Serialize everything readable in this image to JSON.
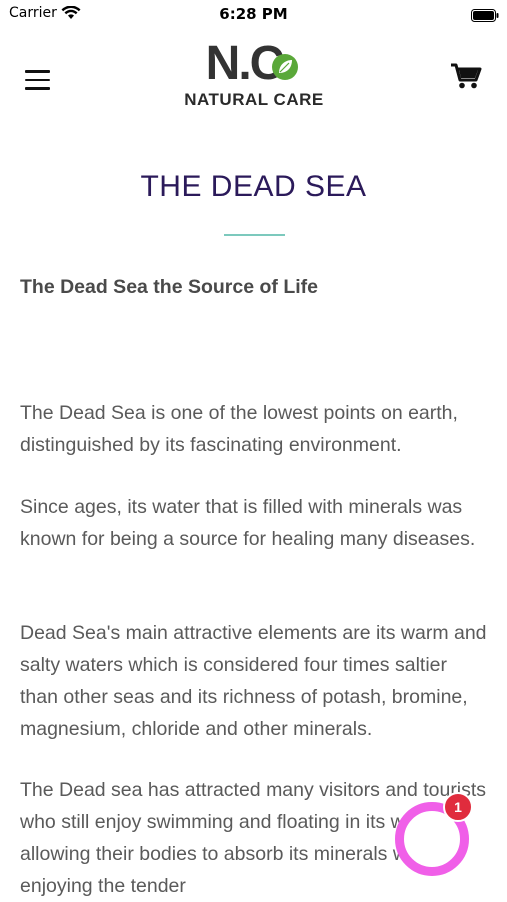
{
  "status_bar": {
    "carrier": "Carrier",
    "time": "6:28 PM"
  },
  "header": {
    "logo_letters": "N.C",
    "logo_text": "NATURAL CARE",
    "menu_icon": "hamburger-menu-icon",
    "cart_icon": "shopping-cart-icon"
  },
  "page": {
    "title": "THE DEAD SEA",
    "subtitle": "The Dead Sea the Source of Life",
    "paragraphs": [
      "The Dead Sea is one of the lowest points on earth, distinguished by its fascinating environment.",
      "Since ages, its water that is filled with minerals was known for being a source for healing many diseases.",
      "Dead Sea's main attractive elements are its warm and salty waters which is considered four times saltier than other seas and its richness of potash, bromine, magnesium, chloride and other minerals.",
      "The Dead sea has attracted many visitors and tourists who still enjoy swimming and floating in its waters, allowing their bodies to absorb its minerals while enjoying the tender"
    ]
  },
  "chat": {
    "badge_count": "1",
    "icon": "chat-bubble-icon"
  },
  "colors": {
    "title": "#2b1a5a",
    "divider": "#7cc9bd",
    "chat": "#f05fe8",
    "badge": "#e02c3d"
  }
}
